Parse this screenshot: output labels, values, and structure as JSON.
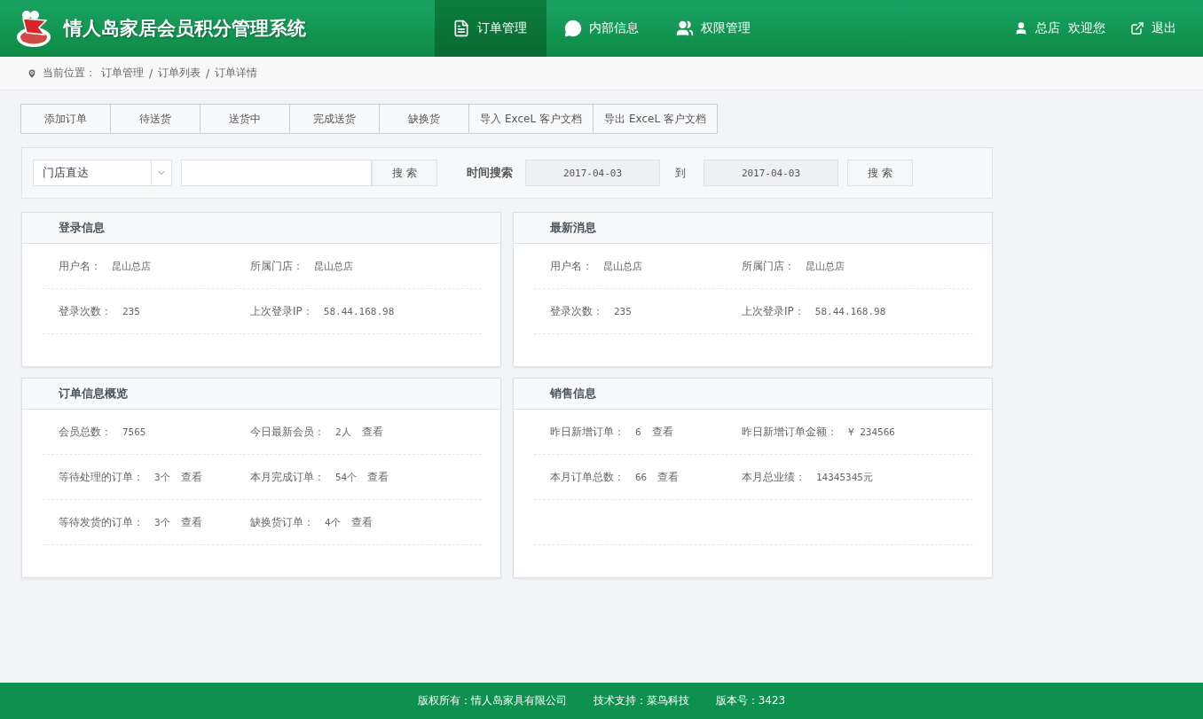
{
  "header": {
    "title": "情人岛家居会员积分管理系统",
    "nav": [
      {
        "label": "订单管理",
        "selected": true
      },
      {
        "label": "内部信息",
        "selected": false
      },
      {
        "label": "权限管理",
        "selected": false
      }
    ],
    "user": "总店  欢迎您",
    "logout": "退出"
  },
  "breadcrumb": {
    "prefix": "当前位置：",
    "items": [
      "订单管理",
      "订单列表",
      "订单详情"
    ],
    "separator": "/"
  },
  "actions": [
    "添加订单",
    "待送货",
    "送货中",
    "完成送货",
    "缺换货",
    "导入 ExceL 客户文档",
    "导出 ExceL 客户文档"
  ],
  "search": {
    "select": "门店直达",
    "button": "搜 索",
    "time_label": "时间搜索",
    "date_from": "2017-04-03",
    "to": "到",
    "date_to": "2017-04-03",
    "button2": "搜 索"
  },
  "panels": [
    {
      "title": "登录信息",
      "rows": [
        [
          {
            "label": "用户名：",
            "value": "昆山总店"
          },
          {
            "label": "所属门店：",
            "value": "昆山总店"
          }
        ],
        [
          {
            "label": "登录次数：",
            "value": "235"
          },
          {
            "label": "上次登录IP：",
            "value": "58.44.168.98"
          }
        ]
      ]
    },
    {
      "title": "最新消息",
      "rows": [
        [
          {
            "label": "用户名：",
            "value": "昆山总店"
          },
          {
            "label": "所属门店：",
            "value": "昆山总店"
          }
        ],
        [
          {
            "label": "登录次数：",
            "value": "235"
          },
          {
            "label": "上次登录IP：",
            "value": "58.44.168.98"
          }
        ]
      ]
    },
    {
      "title": "订单信息概览",
      "rows": [
        [
          {
            "label": "会员总数：",
            "value": "7565"
          },
          {
            "label": "今日最新会员：",
            "value": "2人",
            "link": "查看"
          }
        ],
        [
          {
            "label": "等待处理的订单：",
            "value": "3个",
            "link": "查看"
          },
          {
            "label": "本月完成订单：",
            "value": "54个",
            "link": "查看"
          }
        ],
        [
          {
            "label": "等待发货的订单：",
            "value": "3个",
            "link": "查看"
          },
          {
            "label": "缺换货订单：",
            "value": "4个",
            "link": "查看"
          }
        ]
      ]
    },
    {
      "title": "销售信息",
      "rows": [
        [
          {
            "label": "昨日新增订单：",
            "value": "6",
            "link": "查看"
          },
          {
            "label": "昨日新增订单金额：",
            "value": "¥ 234566"
          }
        ],
        [
          {
            "label": "本月订单总数：",
            "value": "66",
            "link": "查看"
          },
          {
            "label": "本月总业绩：",
            "value": "14345345元"
          }
        ],
        []
      ]
    }
  ],
  "footer": [
    {
      "label": "版权所有：",
      "value": "情人岛家具有限公司"
    },
    {
      "label": "技术支持：",
      "value": "菜鸟科技"
    },
    {
      "label": "版本号：",
      "value": "3423"
    }
  ]
}
